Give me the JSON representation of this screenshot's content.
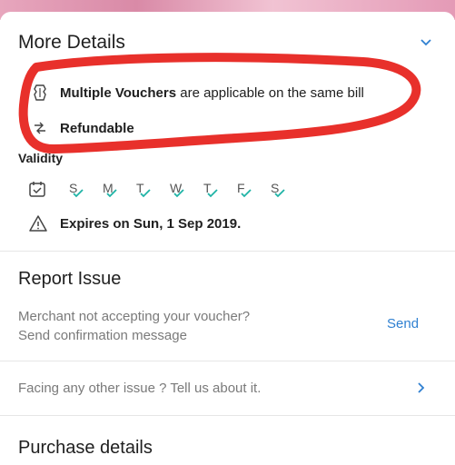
{
  "more_details": {
    "title": "More Details",
    "features": [
      {
        "icon": "voucher-icon",
        "bold": "Multiple Vouchers",
        "rest": " are applicable on the same bill"
      },
      {
        "icon": "refund-icon",
        "bold": "Refundable",
        "rest": ""
      }
    ],
    "validity_label": "Validity",
    "days": [
      "S",
      "M",
      "T",
      "W",
      "T",
      "F",
      "S"
    ],
    "expires_text": "Expires on Sun, 1 Sep 2019."
  },
  "report_issue": {
    "title": "Report Issue",
    "merchant_line1": "Merchant not accepting your voucher?",
    "merchant_line2": "Send confirmation message",
    "send_label": "Send",
    "other_issue": "Facing any other issue ? Tell us about it."
  },
  "purchase_details": {
    "title": "Purchase details"
  },
  "colors": {
    "accent_blue": "#2f80d1",
    "check_teal": "#1fb3a6",
    "annotation_red": "#e8302b"
  }
}
